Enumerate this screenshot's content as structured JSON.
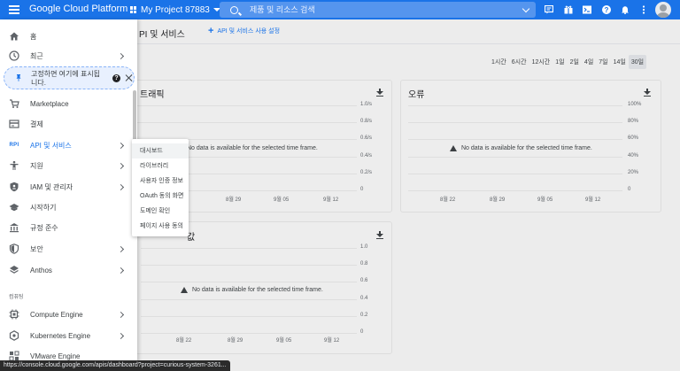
{
  "topbar": {
    "brand": "Google Cloud Platform",
    "project": "My Project 87883",
    "search_placeholder": "제품 및 리소스 검색"
  },
  "subheader": {
    "title": "PI 및 서비스",
    "enable_label": "API 및 서비스 사용 설정"
  },
  "time_range": [
    "1시간",
    "6시간",
    "12시간",
    "1일",
    "2일",
    "4일",
    "7일",
    "14일",
    "30일"
  ],
  "time_range_active": "30일",
  "cards": {
    "traffic": {
      "title": "트래픽",
      "yticks": [
        "1.0/s",
        "0.8/s",
        "0.6/s",
        "0.4/s",
        "0.2/s",
        "0"
      ],
      "xticks": [
        "8월 29",
        "9월 05",
        "9월 12"
      ],
      "nodata": "No data is available for the selected time frame."
    },
    "errors": {
      "title": "오류",
      "yticks": [
        "100%",
        "80%",
        "60%",
        "40%",
        "20%",
        "0"
      ],
      "xticks": [
        "8월 22",
        "8월 29",
        "9월 05",
        "9월 12"
      ],
      "nodata": "No data is available for the selected time frame."
    },
    "latency": {
      "title": "값",
      "yticks": [
        "1.0",
        "0.8",
        "0.6",
        "0.4",
        "0.2",
        "0"
      ],
      "xticks": [
        "8월 22",
        "8월 29",
        "9월 05",
        "9월 12"
      ],
      "nodata": "No data is available for the selected time frame."
    }
  },
  "nav": {
    "items": [
      {
        "label": "홈",
        "icon": "home-icon"
      },
      {
        "label": "최근",
        "icon": "clock-icon"
      },
      {
        "label": "Marketplace",
        "icon": "cart-icon"
      },
      {
        "label": "결제",
        "icon": "billing-icon"
      },
      {
        "label": "API 및 서비스",
        "icon": "api-icon"
      },
      {
        "label": "지원",
        "icon": "support-icon"
      },
      {
        "label": "IAM 및 관리자",
        "icon": "shield-icon"
      },
      {
        "label": "시작하기",
        "icon": "school-icon"
      },
      {
        "label": "규정 준수",
        "icon": "building-icon"
      },
      {
        "label": "보안",
        "icon": "security-icon"
      },
      {
        "label": "Anthos",
        "icon": "anthos-icon"
      },
      {
        "label": "Compute Engine",
        "icon": "chip-icon"
      },
      {
        "label": "Kubernetes Engine",
        "icon": "kubernetes-icon"
      },
      {
        "label": "VMware Engine",
        "icon": "vmware-icon"
      }
    ],
    "pin_text": "고정하면 여기에 표시됩니다.",
    "api_icon_text": "RPI",
    "section_compute": "컴퓨팅"
  },
  "submenu": [
    "대시보드",
    "라이브러리",
    "사용자 인증 정보",
    "OAuth 동의 화면",
    "도메인 확인",
    "페이지 사용 동의"
  ],
  "status_url": "https://console.cloud.google.com/apis/dashboard?project=curious-system-3261..."
}
